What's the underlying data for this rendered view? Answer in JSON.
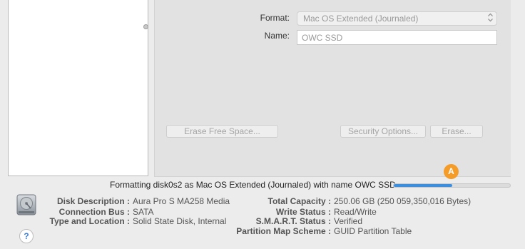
{
  "form": {
    "format_label": "Format:",
    "format_value": "Mac OS Extended (Journaled)",
    "name_label": "Name:",
    "name_value": "OWC SSD"
  },
  "buttons": {
    "erase_free_space": "Erase Free Space...",
    "security_options": "Security Options...",
    "erase": "Erase..."
  },
  "progress": {
    "status_text": "Formatting disk0s2 as Mac OS Extended (Journaled) with name OWC SSD",
    "fraction": 0.5,
    "badge": "A",
    "colors": {
      "fill": "#3b8fe0",
      "badge": "#f49b28"
    }
  },
  "info": {
    "left": [
      {
        "label": "Disk Description :",
        "value": "Aura Pro S MA258 Media"
      },
      {
        "label": "Connection Bus :",
        "value": "SATA"
      },
      {
        "label": "Type and Location :",
        "value": "Solid State Disk, Internal"
      }
    ],
    "right": [
      {
        "label": "Total Capacity :",
        "value": "250.06 GB (250 059,350,016 Bytes)"
      },
      {
        "label": "Write Status :",
        "value": "Read/Write"
      },
      {
        "label": "S.M.A.R.T. Status :",
        "value": "Verified"
      },
      {
        "label": "Partition Map Scheme :",
        "value": "GUID Partition Table"
      }
    ]
  },
  "icons": {
    "disk": "internal-disk-icon",
    "help": "?"
  }
}
